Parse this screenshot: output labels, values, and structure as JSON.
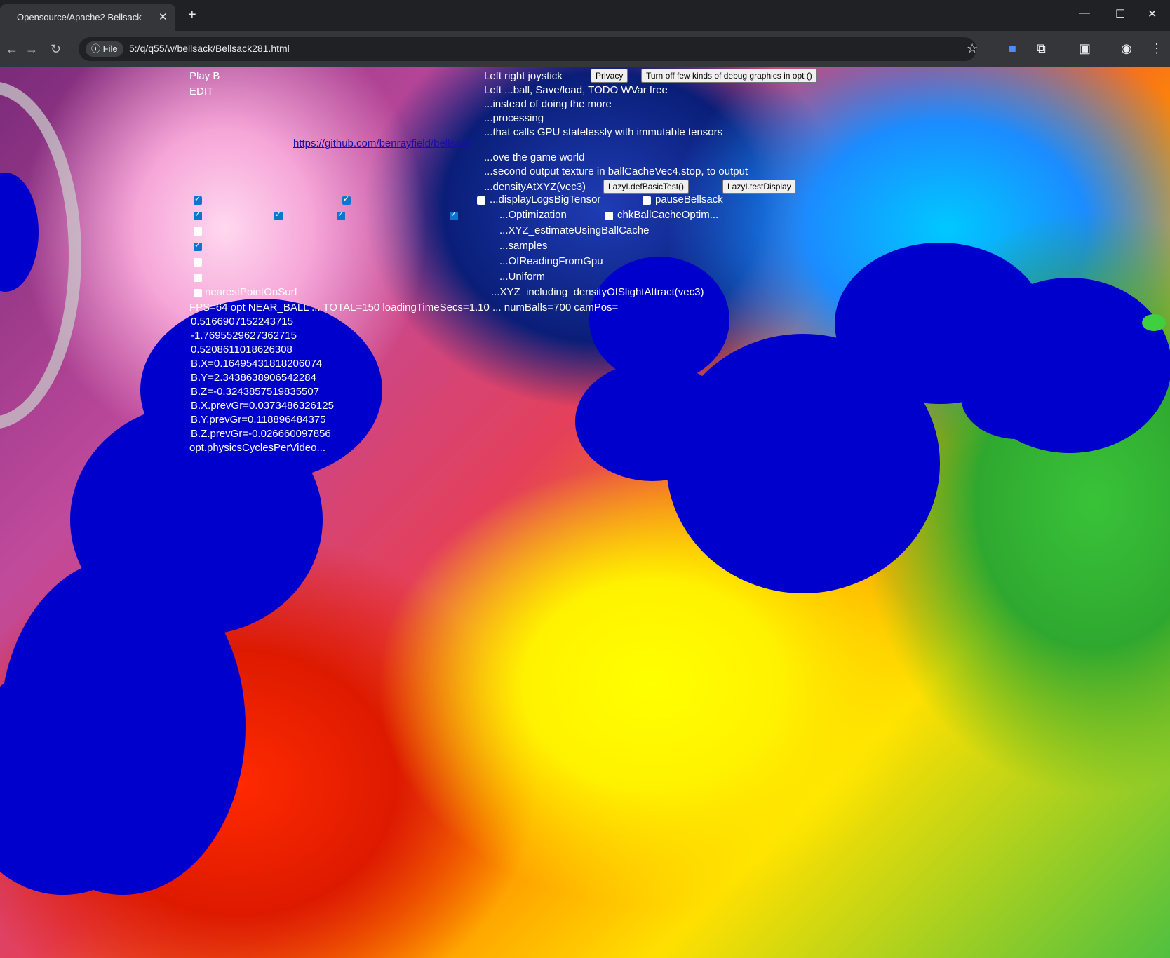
{
  "browser": {
    "tab_title": "Opensource/Apache2 Bellsack",
    "url_chip": "File",
    "url": "5:/q/q55/w/bellsack/Bellsack281.html",
    "new_tab_label": "+",
    "close_tab_label": "✕"
  },
  "overlay": {
    "left_labels": [
      "Play B",
      "EDIT"
    ],
    "right_lines": [
      "Left right joystick",
      "Left ...ball, Save/load, TODO WVar free",
      "...instead of doing the more",
      "...processing",
      "...that calls GPU statelessly with immutable tensors",
      "...ove the game world",
      "...second output texture in ballCacheVec4.stop, to output",
      "...densityAtXYZ(vec3)"
    ],
    "link_text": "https://github.com/benrayfield/bellsack",
    "buttons": {
      "privacy": "Privacy",
      "turn_off_debug": "Turn off few kinds of debug graphics in opt ()",
      "lazy_basic": "LazyI.defBasicTest()",
      "lazy_test": "LazyI.testDisplay"
    },
    "checkbox_labels": [
      "...displayLogsBigTensor",
      "pauseBellsack",
      "...Optimization",
      "chkBallCacheOptim...",
      "...XYZ_estimateUsingBallCache",
      "...samples",
      "...OfReadingFromGpu",
      "...Uniform",
      "...XYZ_including_densityOfSlightAttract(vec3)",
      "nearestPointOnSurf"
    ],
    "status_line": "FPS=64 opt NEAR_BALL ... TOTAL=150 loadingTimeSecs=1.10 ... numBalls=700 camPos=",
    "stats": [
      "0.5166907152243715",
      "-1.7695529627362715",
      "0.5208611018626308",
      "B.X=0.16495431818206074",
      "B.Y=2.3438638906542284",
      "B.Z=-0.3243857519835507",
      "B.X.prevGr=0.0373486326125",
      "B.Y.prevGr=0.118896484375",
      "B.Z.prevGr=-0.026660097856",
      "opt.physicsCyclesPerVideo..."
    ]
  },
  "colors": {
    "ball": "#0000cc",
    "link": "#1a0dab",
    "checkbox_checked": "#0b75d1"
  },
  "icons": {
    "back": "arrow-left-icon",
    "forward": "arrow-right-icon",
    "reload": "reload-icon",
    "info": "info-icon",
    "star": "star-icon",
    "extensions": "puzzle-icon",
    "profile": "profile-icon",
    "menu": "kebab-menu-icon"
  }
}
